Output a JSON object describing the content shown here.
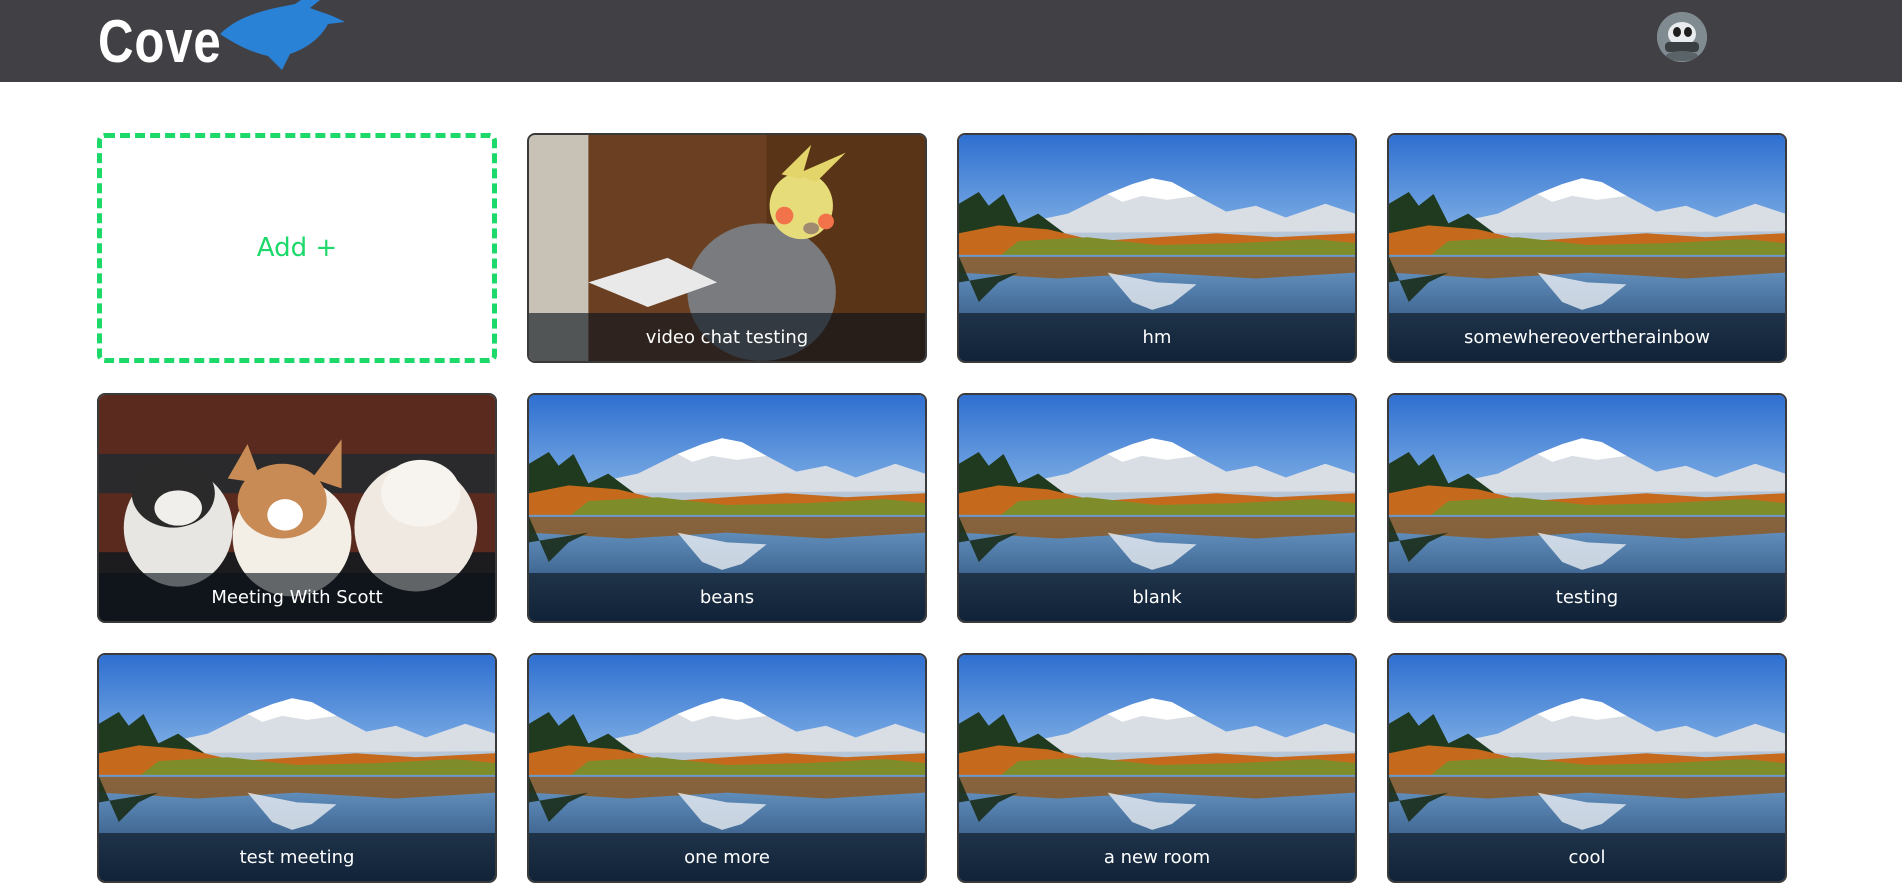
{
  "header": {
    "logo_text": "Cove",
    "avatar_icon": "user-avatar-icon"
  },
  "colors": {
    "header_bg": "#414044",
    "accent": "#1cd96a",
    "logo_bird": "#2a82d6"
  },
  "add_card": {
    "label": "Add +"
  },
  "rooms": [
    {
      "name": "video chat testing",
      "image": "cockatiel"
    },
    {
      "name": "hm",
      "image": "mountain-lake"
    },
    {
      "name": "somewhereovertherainbow",
      "image": "mountain-lake"
    },
    {
      "name": "Meeting With Scott",
      "image": "puppies"
    },
    {
      "name": "beans",
      "image": "mountain-lake"
    },
    {
      "name": "blank",
      "image": "mountain-lake"
    },
    {
      "name": "testing",
      "image": "mountain-lake"
    },
    {
      "name": "test meeting",
      "image": "mountain-lake"
    },
    {
      "name": "one more",
      "image": "mountain-lake"
    },
    {
      "name": "a new room",
      "image": "mountain-lake"
    },
    {
      "name": "cool",
      "image": "mountain-lake"
    }
  ]
}
